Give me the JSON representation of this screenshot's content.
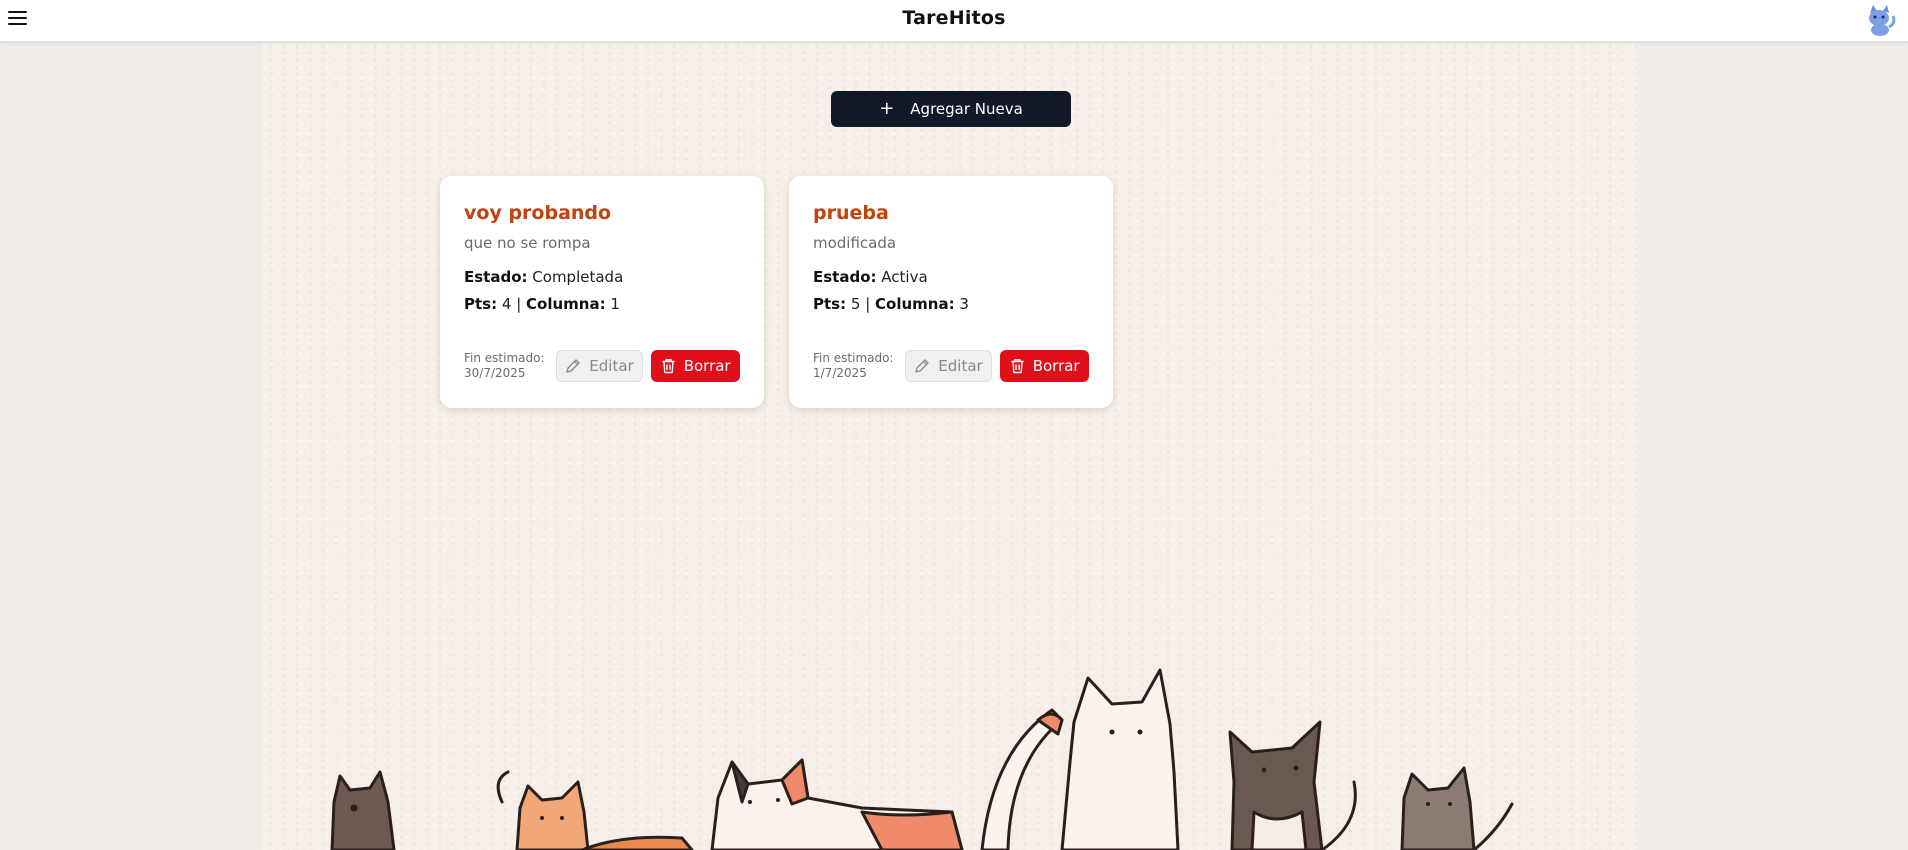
{
  "header": {
    "title": "TareHitos",
    "menu_icon": "hamburger-menu-icon",
    "avatar_icon": "blue-cat-avatar-icon"
  },
  "toolbar": {
    "add_label": "Agregar Nueva",
    "add_icon": "plus-icon"
  },
  "labels": {
    "estado": "Estado:",
    "pts": "Pts:",
    "separator": "|",
    "columna": "Columna:",
    "fin": "Fin estimado:",
    "edit": "Editar",
    "delete": "Borrar"
  },
  "tasks": [
    {
      "title": "voy probando",
      "description": "que no se rompa",
      "estado": "Completada",
      "pts": "4",
      "columna": "1",
      "fin": "30/7/2025"
    },
    {
      "title": "prueba",
      "description": "modificada",
      "estado": "Activa",
      "pts": "5",
      "columna": "3",
      "fin": "1/7/2025"
    }
  ],
  "colors": {
    "accent_title": "#c2410c",
    "primary_button": "#111827",
    "danger_button": "#e0101a",
    "page_bg": "#f5efe8"
  },
  "decor": {
    "illustration": "row-of-cartoon-cats-illustration"
  }
}
